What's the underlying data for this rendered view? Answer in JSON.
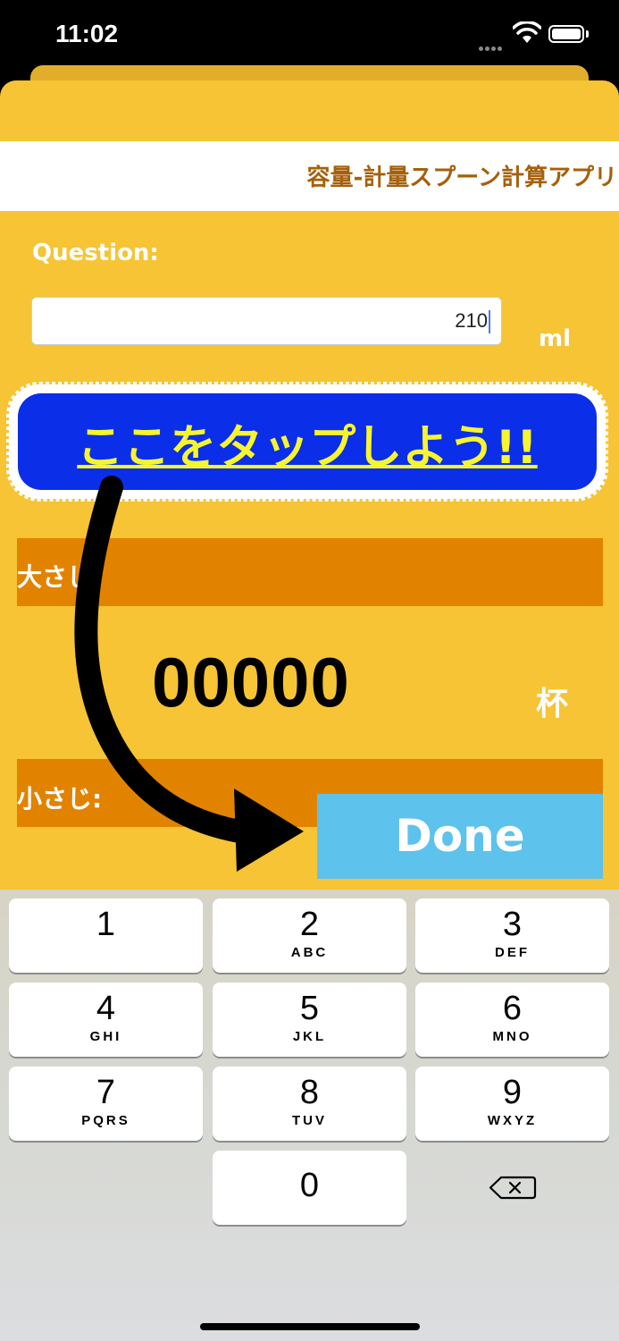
{
  "status": {
    "time": "11:02",
    "icons": [
      "signal-icon",
      "wifi-icon",
      "battery-icon"
    ]
  },
  "app": {
    "title": "容量-計量スプーン計算アプリ",
    "question_label": "Question:",
    "input_value": "210",
    "input_unit": "ml",
    "tap_banner": "ここをタップしよう!!",
    "large_spoon_label": "大さじ:",
    "small_spoon_label": "小さじ:",
    "result_value": "00000",
    "result_unit": "杯",
    "done_label": "Done"
  },
  "keyboard": {
    "keys": [
      {
        "num": "1",
        "letters": ""
      },
      {
        "num": "2",
        "letters": "ABC"
      },
      {
        "num": "3",
        "letters": "DEF"
      },
      {
        "num": "4",
        "letters": "GHI"
      },
      {
        "num": "5",
        "letters": "JKL"
      },
      {
        "num": "6",
        "letters": "MNO"
      },
      {
        "num": "7",
        "letters": "PQRS"
      },
      {
        "num": "8",
        "letters": "TUV"
      },
      {
        "num": "9",
        "letters": "WXYZ"
      },
      {
        "num": "0",
        "letters": ""
      }
    ],
    "delete_icon": "delete-backspace-icon"
  },
  "colors": {
    "background": "#f6c434",
    "bar": "#e28300",
    "banner": "#0b2ee8",
    "banner_text": "#f6f52e",
    "done": "#5dc2ec",
    "title": "#a5600c"
  }
}
